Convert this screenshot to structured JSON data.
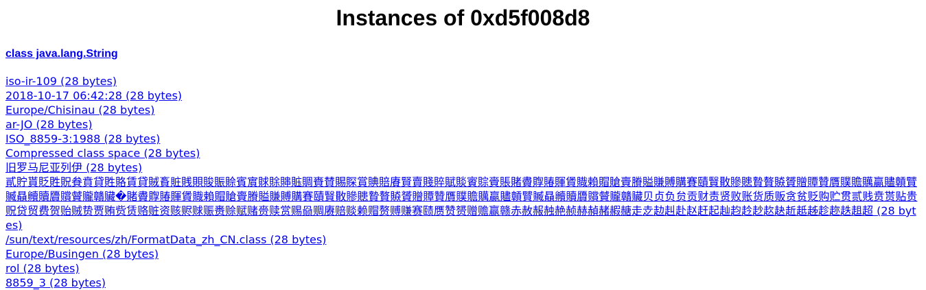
{
  "page": {
    "title": "Instances of 0xd5f008d8"
  },
  "class_link": {
    "label": "class java.lang.String"
  },
  "instances": [
    {
      "text": "iso-ir-109 (28 bytes)"
    },
    {
      "text": "2018-10-17 06:42:28 (28 bytes)"
    },
    {
      "text": "Europe/Chisinau (28 bytes)"
    },
    {
      "text": "ar-JO (28 bytes)"
    },
    {
      "text": "ISO_8859-3:1988 (28 bytes)"
    },
    {
      "text": "Compressed class space (28 bytes)"
    },
    {
      "text": "旧罗马尼亚列伊 (28 bytes)"
    },
    {
      "text": "貳貯貰貶貹貺貵賁貸貹賂賃貸賊賌賍賎賏賐賑賒賓賔賕賖賗賘賙賚賛賜賝賞賟賠賡賢賣賤賥賦賧賨賩賫賬賭賮賯賰賱賲賳賴賵賶賷賸賹賺賻購賽賾贀贁贂贃贄贅贆贇贈贉贊贋贌贍贎贏贐贑贒贓贔贕贖贗贘贙贚贛贜�賭賮賯賰賱賲賳賴賵賶賷賸賹賺賻購賽賾贀贁贂贃贄贅贆贇贈贉贊贋贌贍贎贏贐贑贒贓贔贕贖贗贘贙贚贛贜贝贞负贠贡财责贤败账货质贩贪贫贬购贮贯贰贱贲贳贴贵贶贷贸费贺贻贼贽贾贿赀赁赂赃资赅赆赇赈赉赊赋赌赍赎赏赐赑赒赓赔赕赖赗赘赙赚赛赜赝赞赟赠赡赢赣赤赦赧赨赩赪赫赬赭赮赯走赱赲赳赴赵赶起赸赹赺赻赼赽赾赿趀趁趂趃趄超 (28 bytes)"
    },
    {
      "text": "/sun/text/resources/zh/FormatData_zh_CN.class (28 bytes)"
    },
    {
      "text": "Europe/Busingen (28 bytes)"
    },
    {
      "text": "rol (28 bytes)"
    },
    {
      "text": "8859_3 (28 bytes)"
    }
  ],
  "colors": {
    "link": "#0000ee",
    "text": "#000000",
    "background": "#ffffff"
  }
}
